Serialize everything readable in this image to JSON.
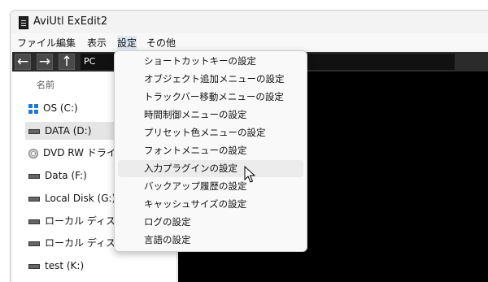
{
  "window": {
    "title": "AviUtl ExEdit2"
  },
  "menubar": {
    "items": [
      "ファイル",
      "編集",
      "表示",
      "設定",
      "その他"
    ]
  },
  "navbar": {
    "back": "←",
    "forward": "→",
    "up": "↑",
    "path": "PC"
  },
  "left_pane": {
    "column_header": "名前",
    "drives": [
      {
        "label": "OS (C:)",
        "icon": "windows-drive-icon"
      },
      {
        "label": "DATA (D:)",
        "icon": "drive-icon",
        "selected": true
      },
      {
        "label": "DVD RW ドライブ",
        "icon": "optical-drive-icon"
      },
      {
        "label": "Data (F:)",
        "icon": "drive-icon"
      },
      {
        "label": "Local Disk (G:)",
        "icon": "drive-icon"
      },
      {
        "label": "ローカル ディスク (H",
        "icon": "drive-icon"
      },
      {
        "label": "ローカル ディスク (I:",
        "icon": "drive-icon"
      },
      {
        "label": "test (K:)",
        "icon": "drive-icon"
      }
    ]
  },
  "settings_menu": {
    "items": [
      "ショートカットキーの設定",
      "オブジェクト追加メニューの設定",
      "トラックバー移動メニューの設定",
      "時間制御メニューの設定",
      "プリセット色メニューの設定",
      "フォントメニューの設定",
      "入力プラグインの設定",
      "バックアップ履歴の設定",
      "キャッシュサイズの設定",
      "ログの設定",
      "言語の設定"
    ],
    "hovered_index": 6
  },
  "colors": {
    "nav_bg": "#2b2b2b",
    "preview_bg": "#000000",
    "menu_bg": "#f9f9f9",
    "hover": "#ececec"
  }
}
